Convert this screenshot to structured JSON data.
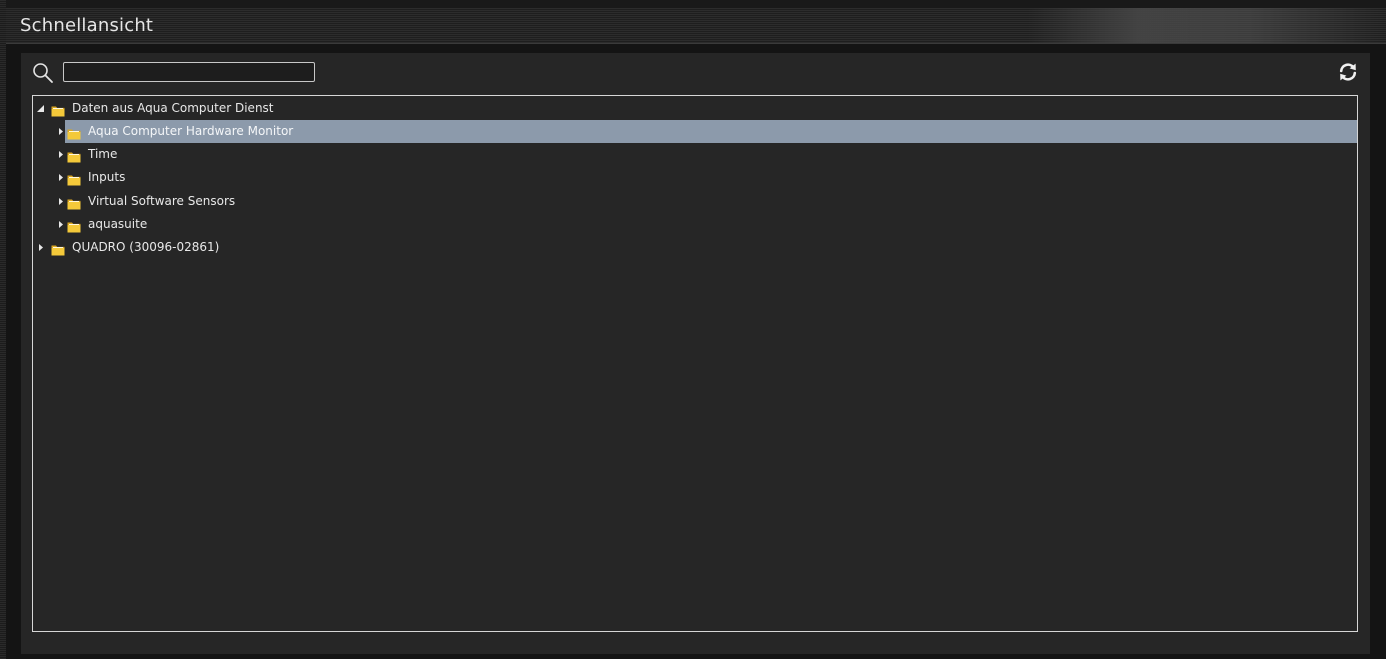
{
  "window": {
    "title": "Schnellansicht"
  },
  "search": {
    "value": "",
    "placeholder": ""
  },
  "icons": {
    "search": "search-icon",
    "refresh": "refresh-icon",
    "folder": "folder-icon",
    "expanded": "triangle-down-icon",
    "collapsed": "triangle-right-icon"
  },
  "colors": {
    "folder": "#f2c230",
    "selection": "#8c9aab",
    "background": "#262626"
  },
  "tree": {
    "root1": {
      "label": "Daten aus Aqua Computer Dienst",
      "expanded": true,
      "children": [
        {
          "label": "Aqua Computer Hardware Monitor",
          "selected": true
        },
        {
          "label": "Time"
        },
        {
          "label": "Inputs"
        },
        {
          "label": "Virtual Software Sensors"
        },
        {
          "label": "aquasuite"
        }
      ]
    },
    "root2": {
      "label": "QUADRO (30096-02861)",
      "expanded": false
    }
  }
}
